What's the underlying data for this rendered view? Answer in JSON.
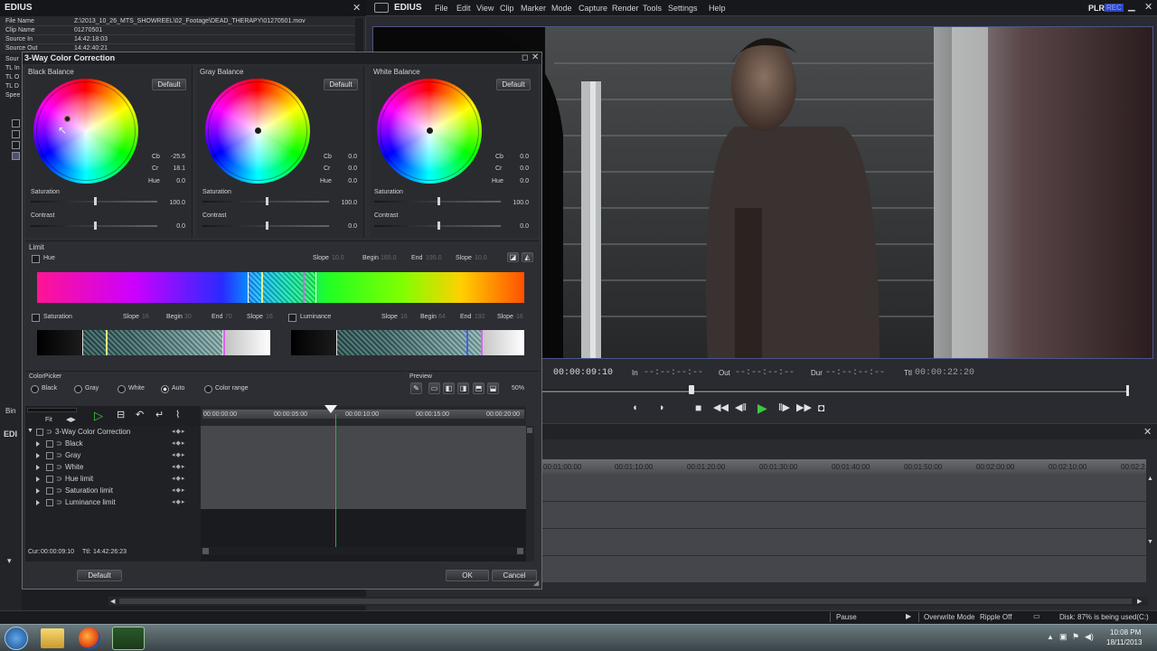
{
  "info_panel": {
    "title": "EDIUS",
    "rows": [
      {
        "key": "File Name",
        "value": "Z:\\2013_10_26_MTS_SHOWREEL\\02_Footage\\DEAD_THERAPY\\01270501.mov"
      },
      {
        "key": "Clip Name",
        "value": "01270501"
      },
      {
        "key": "Source In",
        "value": "14:42:18:03"
      },
      {
        "key": "Source Out",
        "value": "14:42:40:21"
      }
    ],
    "partial_rows": [
      "Sour",
      "TL In",
      "TL O",
      "TL D",
      "Spee"
    ]
  },
  "main_window": {
    "logo": "EDIUS",
    "menu": [
      "File",
      "Edit",
      "View",
      "Clip",
      "Marker",
      "Mode",
      "Capture",
      "Render",
      "Tools",
      "Settings",
      "Help"
    ],
    "plr": "PLR",
    "rec": "REC"
  },
  "dialog": {
    "title": "3-Way Color Correction",
    "balances": [
      {
        "label": "Black Balance",
        "default_btn": "Default",
        "cb_label": "Cb",
        "cb": "-25.5",
        "cr_label": "Cr",
        "cr": "18.1",
        "hue_label": "Hue",
        "hue": "0.0",
        "sat_label": "Saturation",
        "sat": "100.0",
        "con_label": "Contrast",
        "con": "0.0"
      },
      {
        "label": "Gray Balance",
        "default_btn": "Default",
        "cb_label": "Cb",
        "cb": "0.0",
        "cr_label": "Cr",
        "cr": "0.0",
        "hue_label": "Hue",
        "hue": "0.0",
        "sat_label": "Saturation",
        "sat": "100.0",
        "con_label": "Contrast",
        "con": "0.0"
      },
      {
        "label": "White Balance",
        "default_btn": "Default",
        "cb_label": "Cb",
        "cb": "0.0",
        "cr_label": "Cr",
        "cr": "0.0",
        "hue_label": "Hue",
        "hue": "0.0",
        "sat_label": "Saturation",
        "sat": "100.0",
        "con_label": "Contrast",
        "con": "0.0"
      }
    ],
    "limit": {
      "label": "Limit",
      "hue": {
        "label": "Hue",
        "slope1_label": "Slope",
        "slope1": "10.0",
        "begin_label": "Begin",
        "begin": "165.0",
        "end_label": "End",
        "end": "195.0",
        "slope2_label": "Slope",
        "slope2": "10.0"
      },
      "saturation": {
        "label": "Saturation",
        "slope1_label": "Slope",
        "slope1": "16",
        "begin_label": "Begin",
        "begin": "30",
        "end_label": "End",
        "end": "70",
        "slope2_label": "Slope",
        "slope2": "16"
      },
      "luminance": {
        "label": "Luminance",
        "slope1_label": "Slope",
        "slope1": "16",
        "begin_label": "Begin",
        "begin": "64",
        "end_label": "End",
        "end": "192",
        "slope2_label": "Slope",
        "slope2": "16"
      }
    },
    "colorpicker": {
      "label": "ColorPicker",
      "options": [
        "Black",
        "Gray",
        "White",
        "Auto",
        "Color range"
      ],
      "selected": "Auto"
    },
    "preview": {
      "label": "Preview",
      "zoom": "50%"
    },
    "keyframe": {
      "fit_label": "Fit",
      "ruler": [
        "00:00:00:00",
        "00:00:05:00",
        "00:00:10:00",
        "00:00:15:00",
        "00:00:20:00"
      ],
      "tracks": [
        "3-Way Color Correction",
        "Black",
        "Gray",
        "White",
        "Hue limit",
        "Saturation limit",
        "Luminance limit"
      ],
      "cur_label": "Cur:",
      "cur": "00:00:09:10",
      "ttl_label": "Ttl:",
      "ttl": "14:42:26:23"
    },
    "buttons": {
      "default": "Default",
      "ok": "OK",
      "cancel": "Cancel"
    }
  },
  "player": {
    "cur": "00:00:09:10",
    "in_label": "In",
    "in": "--:--:--:--",
    "out_label": "Out",
    "out": "--:--:--:--",
    "dur_label": "Dur",
    "dur": "--:--:--:--",
    "ttl_label": "Ttl",
    "ttl": "00:00:22:20"
  },
  "timeline": {
    "ruler": [
      "00:01:00:00",
      "00:01:10:00",
      "00:01:20:00",
      "00:01:30:00",
      "00:01:40:00",
      "00:01:50:00",
      "00:02:00:00",
      "00:02:10:00",
      "00:02:2"
    ]
  },
  "side_labels": {
    "bin": "Bin",
    "edi": "EDI"
  },
  "status_bar": {
    "pause": "Pause",
    "overwrite": "Overwrite Mode",
    "ripple": "Ripple Off",
    "disk": "Disk: 87% is being used(C:)"
  },
  "taskbar": {
    "time": "10:08 PM",
    "date": "18/11/2013"
  },
  "colors": {
    "accent_green": "#3ec83e",
    "window_bg": "#2b2c31",
    "dialog_bg": "#2d2e33"
  }
}
